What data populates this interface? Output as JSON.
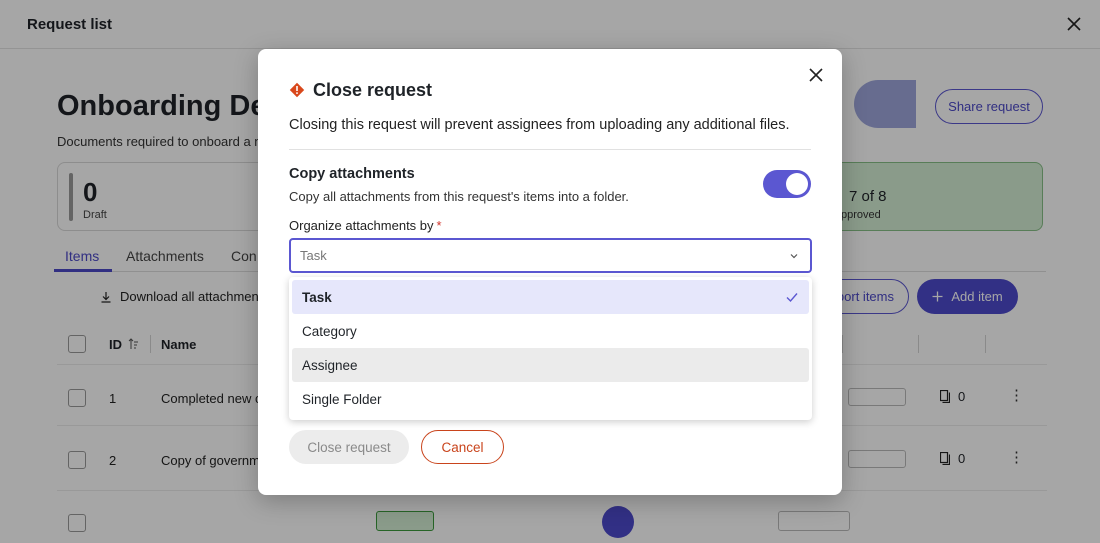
{
  "topbar": {
    "title": "Request list"
  },
  "page": {
    "title": "Onboarding Det",
    "subtitle": "Documents required to onboard a ne",
    "share_label": "Share request"
  },
  "stats": {
    "draft": {
      "count": "0",
      "label": "Draft"
    },
    "approved": {
      "count": "7 of 8",
      "label": "pproved"
    }
  },
  "tabs": [
    {
      "label": "Items"
    },
    {
      "label": "Attachments"
    },
    {
      "label": "Con"
    }
  ],
  "toolbar": {
    "download_label": "Download all attachment",
    "import_label": "port items",
    "add_label": "Add item"
  },
  "table": {
    "headers": {
      "id": "ID",
      "name": "Name"
    },
    "rows": [
      {
        "id": "1",
        "name": "Completed new c",
        "attachments": "0"
      },
      {
        "id": "2",
        "name": "Copy of governm",
        "attachments": "0"
      }
    ]
  },
  "modal": {
    "title": "Close request",
    "description": "Closing this request will prevent assignees from uploading any additional files.",
    "section_title": "Copy attachments",
    "section_description": "Copy all attachments from this request's items into a folder.",
    "toggle_on": true,
    "field_label": "Organize attachments by",
    "required_marker": "*",
    "selected_value": "Task",
    "options": [
      {
        "label": "Task"
      },
      {
        "label": "Category"
      },
      {
        "label": "Assignee"
      },
      {
        "label": "Single Folder"
      }
    ],
    "close_button": "Close request",
    "cancel_button": "Cancel"
  },
  "colors": {
    "accent": "#5b57d1",
    "danger": "#c9441c",
    "approved_bg": "#d5efd5"
  }
}
